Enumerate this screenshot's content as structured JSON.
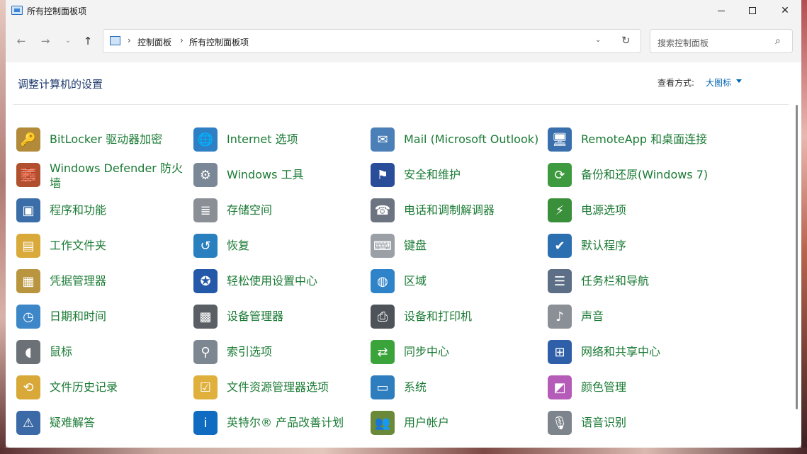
{
  "window": {
    "title": "所有控制面板项",
    "min_symbol": "",
    "max_symbol": "",
    "close_symbol": "✕"
  },
  "nav": {
    "back": "←",
    "forward": "→",
    "recent": "⌄",
    "up": "↑"
  },
  "address": {
    "sep1": "›",
    "crumb1": "控制面板",
    "sep2": "›",
    "crumb2": "所有控制面板项",
    "dropdown": "⌄",
    "refresh": "↻"
  },
  "search": {
    "placeholder": "搜索控制面板",
    "icon": "⌕"
  },
  "header": {
    "title": "调整计算机的设置",
    "view_label": "查看方式:",
    "view_value": "大图标"
  },
  "items": [
    {
      "label": "BitLocker 驱动器加密",
      "icon": "key-lock-icon",
      "color": "#b38a3a",
      "glyph": "🔑"
    },
    {
      "label": "Internet 选项",
      "icon": "globe-checklist-icon",
      "color": "#2f7fc4",
      "glyph": "🌐"
    },
    {
      "label": "Mail (Microsoft Outlook)",
      "icon": "mail-icon",
      "color": "#4a7fb8",
      "glyph": "✉"
    },
    {
      "label": "RemoteApp 和桌面连接",
      "icon": "remote-desktop-icon",
      "color": "#3a6fae",
      "glyph": "🖥"
    },
    {
      "label": "Windows Defender 防火墙",
      "icon": "firewall-icon",
      "color": "#b0502f",
      "glyph": "🧱"
    },
    {
      "label": "Windows 工具",
      "icon": "gear-tools-icon",
      "color": "#7a8796",
      "glyph": "⚙"
    },
    {
      "label": "安全和维护",
      "icon": "flag-icon",
      "color": "#2a4d9a",
      "glyph": "⚑"
    },
    {
      "label": "备份和还原(Windows 7)",
      "icon": "backup-icon",
      "color": "#3e9a3e",
      "glyph": "⟳"
    },
    {
      "label": "程序和功能",
      "icon": "programs-icon",
      "color": "#3b6ea8",
      "glyph": "▣"
    },
    {
      "label": "存储空间",
      "icon": "storage-icon",
      "color": "#8a8f96",
      "glyph": "≣"
    },
    {
      "label": "电话和调制解调器",
      "icon": "phone-modem-icon",
      "color": "#6b7480",
      "glyph": "☎"
    },
    {
      "label": "电源选项",
      "icon": "power-icon",
      "color": "#3a8f3a",
      "glyph": "⚡"
    },
    {
      "label": "工作文件夹",
      "icon": "work-folder-icon",
      "color": "#d9a93a",
      "glyph": "▤"
    },
    {
      "label": "恢复",
      "icon": "recovery-icon",
      "color": "#2a7fbf",
      "glyph": "↺"
    },
    {
      "label": "键盘",
      "icon": "keyboard-icon",
      "color": "#9aa0a6",
      "glyph": "⌨"
    },
    {
      "label": "默认程序",
      "icon": "default-programs-icon",
      "color": "#2c6fb0",
      "glyph": "✔"
    },
    {
      "label": "凭据管理器",
      "icon": "credential-vault-icon",
      "color": "#b8953e",
      "glyph": "▦"
    },
    {
      "label": "轻松使用设置中心",
      "icon": "ease-of-access-icon",
      "color": "#2458a8",
      "glyph": "✪"
    },
    {
      "label": "区域",
      "icon": "region-globe-icon",
      "color": "#2f84c9",
      "glyph": "◍"
    },
    {
      "label": "任务栏和导航",
      "icon": "taskbar-icon",
      "color": "#5c6f86",
      "glyph": "☰"
    },
    {
      "label": "日期和时间",
      "icon": "calendar-clock-icon",
      "color": "#3d86c8",
      "glyph": "◷"
    },
    {
      "label": "设备管理器",
      "icon": "device-manager-icon",
      "color": "#5a5f66",
      "glyph": "▩"
    },
    {
      "label": "设备和打印机",
      "icon": "printer-icon",
      "color": "#4d5359",
      "glyph": "⎙"
    },
    {
      "label": "声音",
      "icon": "speaker-icon",
      "color": "#8a9096",
      "glyph": "♪"
    },
    {
      "label": "鼠标",
      "icon": "mouse-icon",
      "color": "#6c7178",
      "glyph": "◖"
    },
    {
      "label": "索引选项",
      "icon": "indexing-icon",
      "color": "#7d8791",
      "glyph": "⚲"
    },
    {
      "label": "同步中心",
      "icon": "sync-icon",
      "color": "#3aa33a",
      "glyph": "⇄"
    },
    {
      "label": "网络和共享中心",
      "icon": "network-icon",
      "color": "#2e5fa8",
      "glyph": "⊞"
    },
    {
      "label": "文件历史记录",
      "icon": "file-history-icon",
      "color": "#d8a838",
      "glyph": "⟲"
    },
    {
      "label": "文件资源管理器选项",
      "icon": "folder-options-icon",
      "color": "#e0b03c",
      "glyph": "☑"
    },
    {
      "label": "系统",
      "icon": "system-monitor-icon",
      "color": "#2d7dbf",
      "glyph": "▭"
    },
    {
      "label": "颜色管理",
      "icon": "color-management-icon",
      "color": "#b45cb8",
      "glyph": "◩"
    },
    {
      "label": "疑难解答",
      "icon": "troubleshooting-icon",
      "color": "#3b6aa6",
      "glyph": "⚠"
    },
    {
      "label": "英特尔® 产品改善计划",
      "icon": "intel-icon",
      "color": "#0f6cc0",
      "glyph": "i"
    },
    {
      "label": "用户帐户",
      "icon": "user-accounts-icon",
      "color": "#6a8a3a",
      "glyph": "👥"
    },
    {
      "label": "语音识别",
      "icon": "microphone-icon",
      "color": "#7d848c",
      "glyph": "🎙"
    }
  ]
}
